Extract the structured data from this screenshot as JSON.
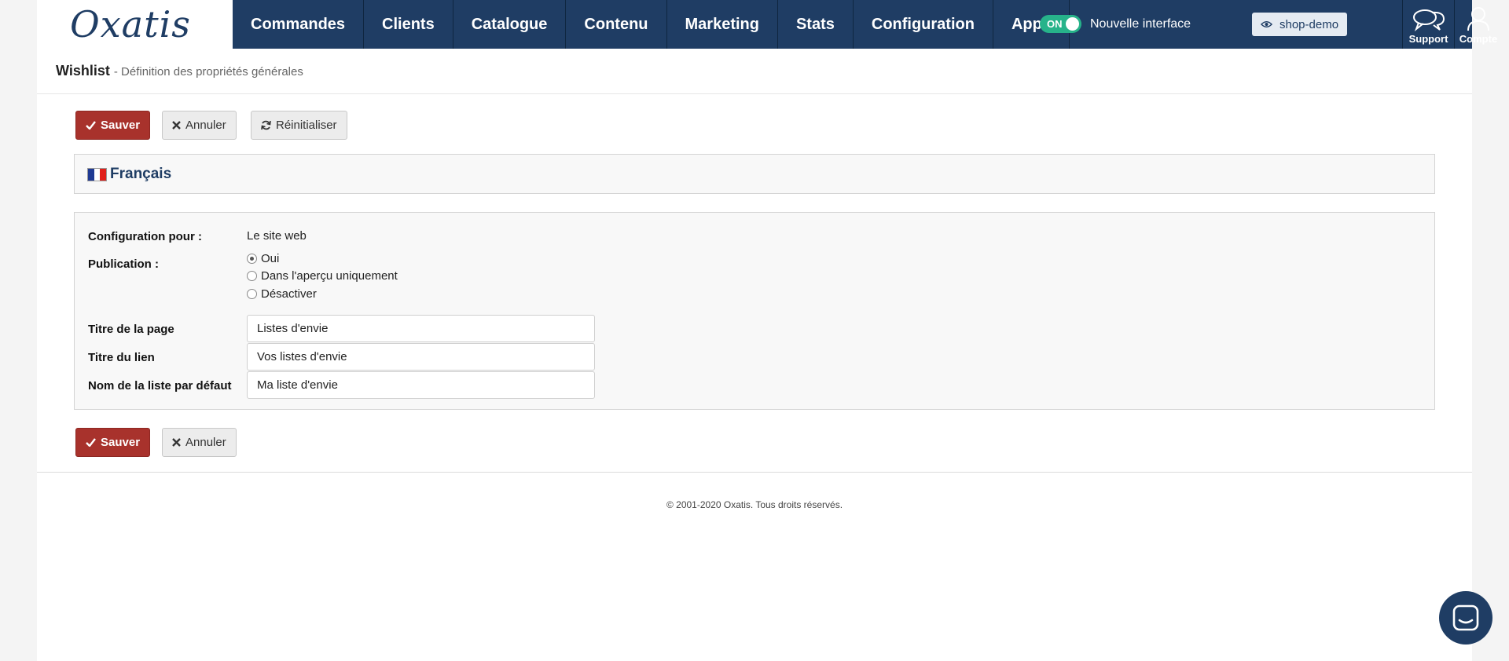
{
  "header": {
    "logo": "Oxatis",
    "nav": [
      "Commandes",
      "Clients",
      "Catalogue",
      "Contenu",
      "Marketing",
      "Stats",
      "Configuration",
      "Apps"
    ],
    "toggle": {
      "state": "ON",
      "label": "Nouvelle interface"
    },
    "shop_button": "shop-demo",
    "support": "Support",
    "account": "Compte"
  },
  "breadcrumb": {
    "title": "Wishlist",
    "subtitle": "- Définition des propriétés générales"
  },
  "actions": {
    "save": "Sauver",
    "cancel": "Annuler",
    "reset": "Réinitialiser"
  },
  "language": {
    "label": "Français",
    "flag_colors": [
      "#1f3a93",
      "#ffffff",
      "#e0201b"
    ]
  },
  "form": {
    "config_label": "Configuration pour :",
    "config_value": "Le site web",
    "publication_label": "Publication :",
    "publication_options": [
      "Oui",
      "Dans l'aperçu uniquement",
      "Désactiver"
    ],
    "publication_selected": "Oui",
    "page_title_label": "Titre de la page",
    "page_title_value": "Listes d'envie",
    "link_title_label": "Titre du lien",
    "link_title_value": "Vos listes d'envie",
    "default_list_label": "Nom de la liste par défaut",
    "default_list_value": "Ma liste d'envie"
  },
  "footer": {
    "copyright": "© 2001-2020 Oxatis. Tous droits réservés."
  },
  "colors": {
    "navy": "#1f3d64",
    "save_red": "#a8322c",
    "toggle_green": "#27b38a"
  }
}
